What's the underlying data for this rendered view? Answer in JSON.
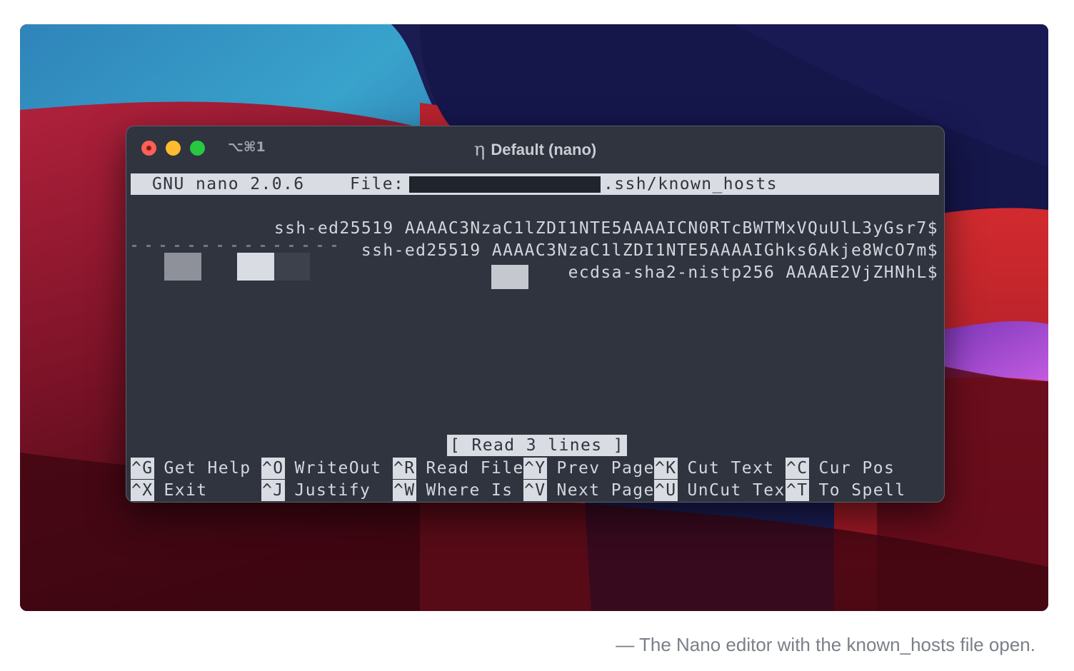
{
  "terminal": {
    "tab_shortcut": "⌥⌘1",
    "title_icon": "η",
    "title": "Default (nano)"
  },
  "nano": {
    "version_label": "GNU nano 2.0.6",
    "file_label": "File:",
    "file_name": ".ssh/known_hosts",
    "lines": [
      "ssh-ed25519 AAAAC3NzaC1lZDI1NTE5AAAAICN0RTcBWTMxVQuUlL3yGsr7$",
      "ssh-ed25519 AAAAC3NzaC1lZDI1NTE5AAAAIGhks6Akje8WcO7m$",
      "ecdsa-sha2-nistp256 AAAAE2VjZHNhL$"
    ],
    "status": "[ Read 3 lines ]",
    "shortcuts": [
      {
        "key": "^G",
        "label": "Get Help"
      },
      {
        "key": "^O",
        "label": "WriteOut"
      },
      {
        "key": "^R",
        "label": "Read File"
      },
      {
        "key": "^Y",
        "label": "Prev Page"
      },
      {
        "key": "^K",
        "label": "Cut Text"
      },
      {
        "key": "^C",
        "label": "Cur Pos"
      },
      {
        "key": "^X",
        "label": "Exit"
      },
      {
        "key": "^J",
        "label": "Justify"
      },
      {
        "key": "^W",
        "label": "Where Is"
      },
      {
        "key": "^V",
        "label": "Next Page"
      },
      {
        "key": "^U",
        "label": "UnCut Tex"
      },
      {
        "key": "^T",
        "label": "To Spell"
      }
    ]
  },
  "caption": "— The Nano editor with the known_hosts file open."
}
